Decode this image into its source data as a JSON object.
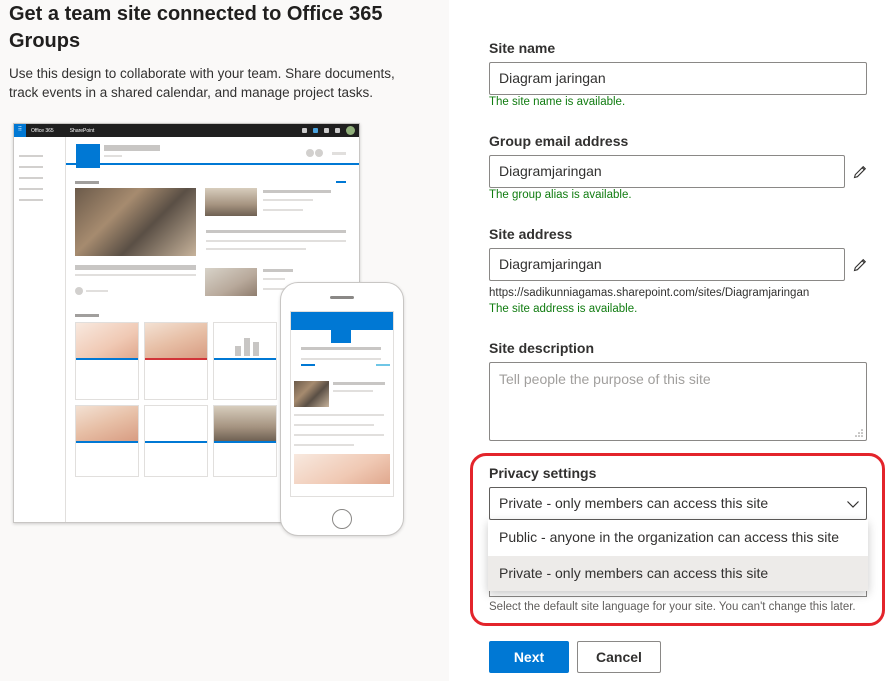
{
  "intro": {
    "title": "Get a team site connected to Office 365 Groups",
    "description": "Use this design to collaborate with your team. Share documents, track events in a shared calendar, and manage project tasks."
  },
  "preview": {
    "suite_label": "Office 365",
    "app_label": "SharePoint"
  },
  "form": {
    "site_name": {
      "label": "Site name",
      "value": "Diagram jaringan",
      "status": "The site name is available."
    },
    "group_email": {
      "label": "Group email address",
      "value": "Diagramjaringan",
      "status": "The group alias is available.",
      "edit_icon": "pencil-icon"
    },
    "site_address": {
      "label": "Site address",
      "value": "Diagramjaringan",
      "url": "https://sadikunniagamas.sharepoint.com/sites/Diagramjaringan",
      "status": "The site address is available.",
      "edit_icon": "pencil-icon"
    },
    "site_description": {
      "label": "Site description",
      "placeholder": "Tell people the purpose of this site",
      "value": ""
    },
    "privacy": {
      "label": "Privacy settings",
      "selected": "Private - only members can access this site",
      "options": [
        "Public - anyone in the organization can access this site",
        "Private - only members can access this site"
      ],
      "highlighted_option_index": 1
    },
    "language_helper": "Select the default site language for your site. You can't change this later.",
    "buttons": {
      "next": "Next",
      "cancel": "Cancel"
    }
  },
  "colors": {
    "accent": "#0078d4",
    "success": "#107c10",
    "highlight_ring": "#e3242b"
  }
}
